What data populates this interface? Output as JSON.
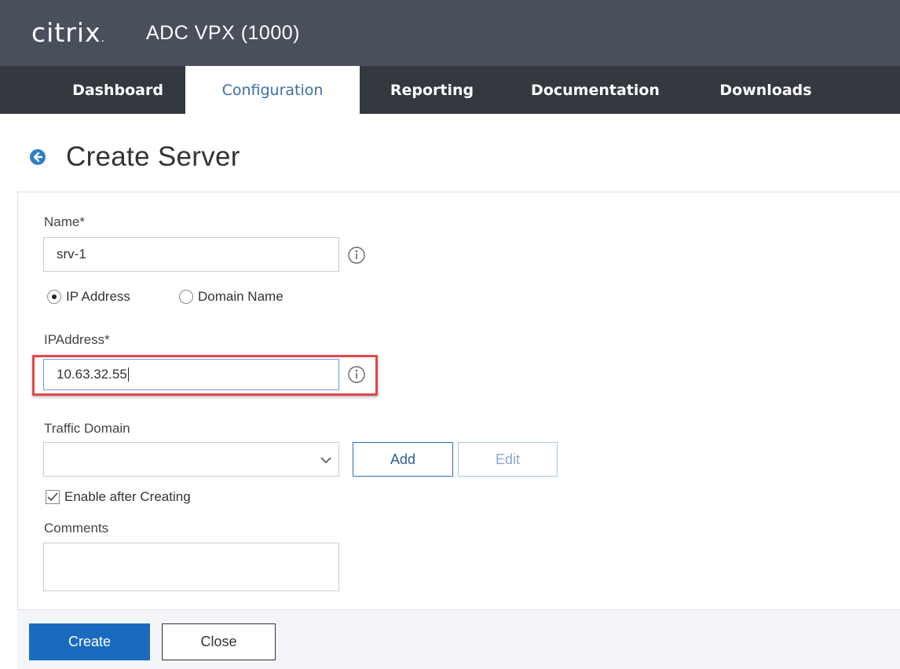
{
  "header": {
    "logo": "citrix",
    "product_title": "ADC VPX (1000)"
  },
  "nav": {
    "tabs": [
      {
        "label": "Dashboard"
      },
      {
        "label": "Configuration"
      },
      {
        "label": "Reporting"
      },
      {
        "label": "Documentation"
      },
      {
        "label": "Downloads"
      }
    ],
    "active_tab": "Configuration"
  },
  "page": {
    "title": "Create Server"
  },
  "form": {
    "name_label": "Name*",
    "name_value": "srv-1",
    "radio_ip_label": "IP Address",
    "radio_domain_label": "Domain Name",
    "radio_selected": "IP Address",
    "ip_label": "IPAddress*",
    "ip_value": "10.63.32.55",
    "traffic_domain_label": "Traffic Domain",
    "traffic_domain_value": "",
    "add_label": "Add",
    "edit_label": "Edit",
    "enable_label": "Enable after Creating",
    "enable_checked": true,
    "comments_label": "Comments",
    "comments_value": ""
  },
  "footer": {
    "create_label": "Create",
    "close_label": "Close"
  },
  "colors": {
    "header_bg": "#4a4f5c",
    "nav_bg": "#34383f",
    "accent": "#1a6bbf",
    "highlight": "#e3474b"
  },
  "icons": {
    "back": "arrow-left-circle-icon",
    "info": "info-circle-icon",
    "dropdown": "chevron-down-icon",
    "check": "checkmark-icon"
  }
}
